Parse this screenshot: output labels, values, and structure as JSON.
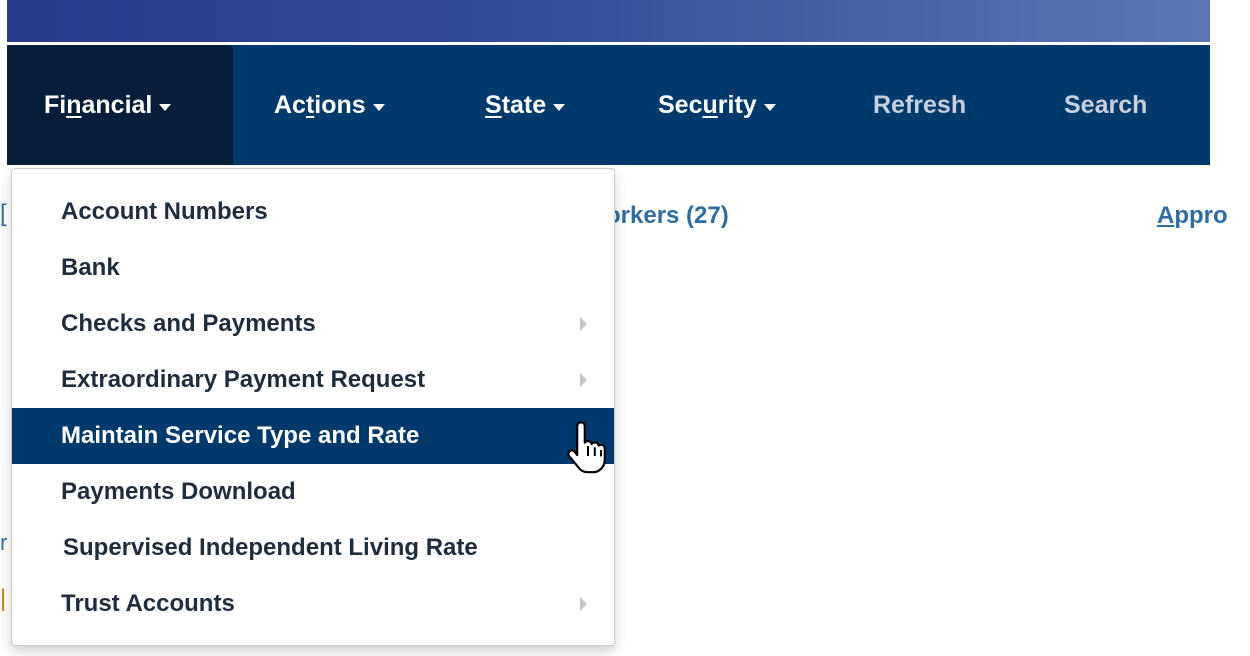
{
  "nav": {
    "items": [
      {
        "label_pre": "Fi",
        "label_u": "n",
        "label_post": "ancial",
        "has_caret": true,
        "active": true
      },
      {
        "label_pre": "Ac",
        "label_u": "t",
        "label_post": "ions",
        "has_caret": true
      },
      {
        "label_pre": "",
        "label_u": "S",
        "label_post": "tate",
        "has_caret": true
      },
      {
        "label_pre": "Sec",
        "label_u": "u",
        "label_post": "rity",
        "has_caret": true
      },
      {
        "label": "Refresh"
      },
      {
        "label": "Search"
      }
    ]
  },
  "dropdown": {
    "items": [
      {
        "label": "Account Numbers"
      },
      {
        "label": "Bank"
      },
      {
        "label": "Checks and Payments",
        "has_submenu": true
      },
      {
        "label": "Extraordinary Payment Request",
        "has_submenu": true
      },
      {
        "label": "Maintain Service Type and Rate",
        "highlighted": true
      },
      {
        "label": "Payments Download"
      },
      {
        "label": "Supervised Independent Living Rate"
      },
      {
        "label": "Trust Accounts",
        "has_submenu": true
      }
    ]
  },
  "background": {
    "workers_link": "orkers (27)",
    "appro_pre": "",
    "appro_u": "A",
    "appro_post": "ppro"
  },
  "colors": {
    "navbar_bg": "#003a6c",
    "active_nav_bg": "#071e3b",
    "highlight_bg": "#003a6c",
    "link_color": "#2e6da4"
  }
}
